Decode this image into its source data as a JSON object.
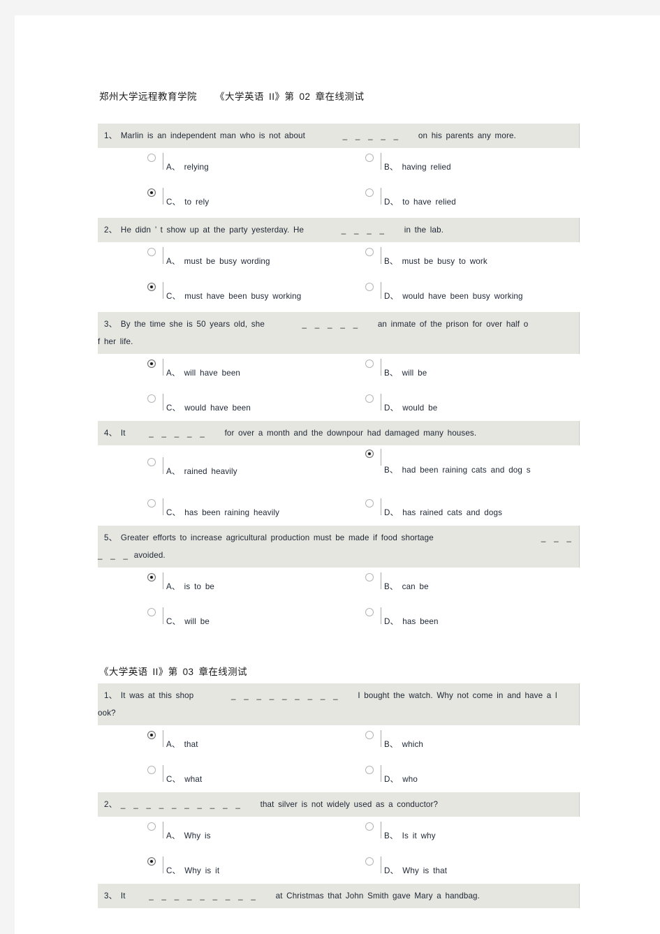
{
  "document": {
    "header": {
      "institution": "郑州大学远程教育学院",
      "course": "《大学英语",
      "course_level": "II",
      "course_tail": "》第",
      "chapter": "02",
      "chapter_tail": "章在线测试"
    },
    "sections": [
      {
        "id": "section-chapter-02",
        "title_prefix": "《大学英语",
        "title_level": "II",
        "title_mid": "》第",
        "title_chapter": "02",
        "title_suffix": "章在线测试",
        "questions": [
          {
            "number": "1、",
            "text_before": "Marlin is an independent man who is not about",
            "blank": "_ _ _ _ _",
            "text_after": "on his parents any more.",
            "wrap_text": "",
            "trailing_blank": "",
            "options": [
              {
                "label": "A、",
                "text": "relying",
                "checked": false
              },
              {
                "label": "B、",
                "text": "having relied",
                "checked": false
              },
              {
                "label": "C、",
                "text": "to rely",
                "checked": true
              },
              {
                "label": "D、",
                "text": "to have relied",
                "checked": false
              }
            ]
          },
          {
            "number": "2、",
            "text_before": "He didn ’ t show up at the party yesterday. He",
            "blank": "_ _ _ _",
            "text_after": "in the lab.",
            "wrap_text": "",
            "trailing_blank": "",
            "options": [
              {
                "label": "A、",
                "text": "must be busy wording",
                "checked": false
              },
              {
                "label": "B、",
                "text": "must be busy to work",
                "checked": false
              },
              {
                "label": "C、",
                "text": "must have been busy working",
                "checked": true
              },
              {
                "label": "D、",
                "text": "would have been busy working",
                "checked": false
              }
            ]
          },
          {
            "number": "3、",
            "text_before": "By the time she is 50 years old, she",
            "blank": "_ _ _ _ _",
            "text_after": "an inmate of the prison for over half o",
            "wrap_text": "f her life.",
            "trailing_blank": "",
            "options": [
              {
                "label": "A、",
                "text": "will have been",
                "checked": true
              },
              {
                "label": "B、",
                "text": "will be",
                "checked": false
              },
              {
                "label": "C、",
                "text": "would have been",
                "checked": false
              },
              {
                "label": "D、",
                "text": "would be",
                "checked": false
              }
            ]
          },
          {
            "number": "4、",
            "text_before": "It",
            "blank": "_ _ _ _ _",
            "text_after": "for over a month and the downpour had damaged many houses.",
            "wrap_text": "",
            "trailing_blank": "",
            "options": [
              {
                "label": "A、",
                "text": "rained heavily",
                "checked": false
              },
              {
                "label": "B、",
                "text": "had been raining cats and dog s",
                "checked": true
              },
              {
                "label": "C、",
                "text": "has been raining heavily",
                "checked": false
              },
              {
                "label": "D、",
                "text": "has rained cats and dogs",
                "checked": false
              }
            ]
          },
          {
            "number": "5、",
            "text_before": "Greater efforts to increase agricultural production must be made if food shortage",
            "blank": "",
            "text_after": "",
            "trailing_blank": "_ _ _",
            "wrap_blank": "_ _ _",
            "wrap_text": "avoided.",
            "options": [
              {
                "label": "A、",
                "text": "is to be",
                "checked": true
              },
              {
                "label": "B、",
                "text": "can be",
                "checked": false
              },
              {
                "label": "C、",
                "text": "will be",
                "checked": false
              },
              {
                "label": "D、",
                "text": "has been",
                "checked": false
              }
            ]
          }
        ]
      },
      {
        "id": "section-chapter-03",
        "title_prefix": "《大学英语",
        "title_level": "II",
        "title_mid": "》第",
        "title_chapter": "03",
        "title_suffix": "章在线测试",
        "questions": [
          {
            "number": "1、",
            "text_before": "It was at this shop",
            "blank": "_ _ _ _ _ _ _ _ _",
            "text_after": "I bought the watch. Why not come in and have a l",
            "wrap_text": "ook?",
            "trailing_blank": "",
            "options": [
              {
                "label": "A、",
                "text": "that",
                "checked": true
              },
              {
                "label": "B、",
                "text": "which",
                "checked": false
              },
              {
                "label": "C、",
                "text": "what",
                "checked": false
              },
              {
                "label": "D、",
                "text": "who",
                "checked": false
              }
            ]
          },
          {
            "number": "2、",
            "text_before": "",
            "blank": "_ _ _ _ _ _ _ _ _ _",
            "text_after": "that silver is not widely used as a conductor?",
            "wrap_text": "",
            "trailing_blank": "",
            "options": [
              {
                "label": "A、",
                "text": "Why is",
                "checked": false
              },
              {
                "label": "B、",
                "text": "Is it why",
                "checked": false
              },
              {
                "label": "C、",
                "text": "Why is it",
                "checked": true
              },
              {
                "label": "D、",
                "text": "Why is that",
                "checked": false
              }
            ]
          },
          {
            "number": "3、",
            "text_before": "It",
            "blank": "_ _ _ _ _ _ _ _ _",
            "text_after": "at Christmas that John Smith gave Mary a handbag.",
            "wrap_text": "",
            "trailing_blank": "",
            "options": []
          }
        ]
      }
    ]
  }
}
